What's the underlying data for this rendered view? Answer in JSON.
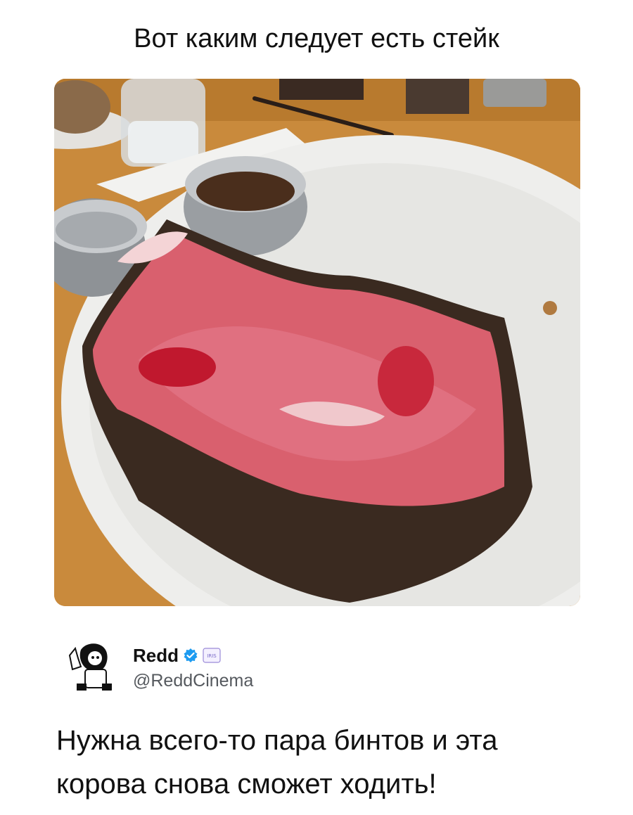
{
  "post": {
    "title": "Вот каким следует есть стейк"
  },
  "photo": {
    "subject": "steak-photo"
  },
  "tweet": {
    "display_name": "Redd",
    "handle": "@ReddCinema",
    "text": "Нужна всего-то пара бинтов и эта корова снова сможет ходить!",
    "affiliate_badge_text": "IRIS"
  },
  "colors": {
    "verified_blue": "#1d9bf0",
    "text": "#111111",
    "handle_gray": "#55595e",
    "table_wood": "#c98a3c",
    "plate": "#eeeeec",
    "meat_red": "#d9606e",
    "crust": "#3a2a20"
  }
}
